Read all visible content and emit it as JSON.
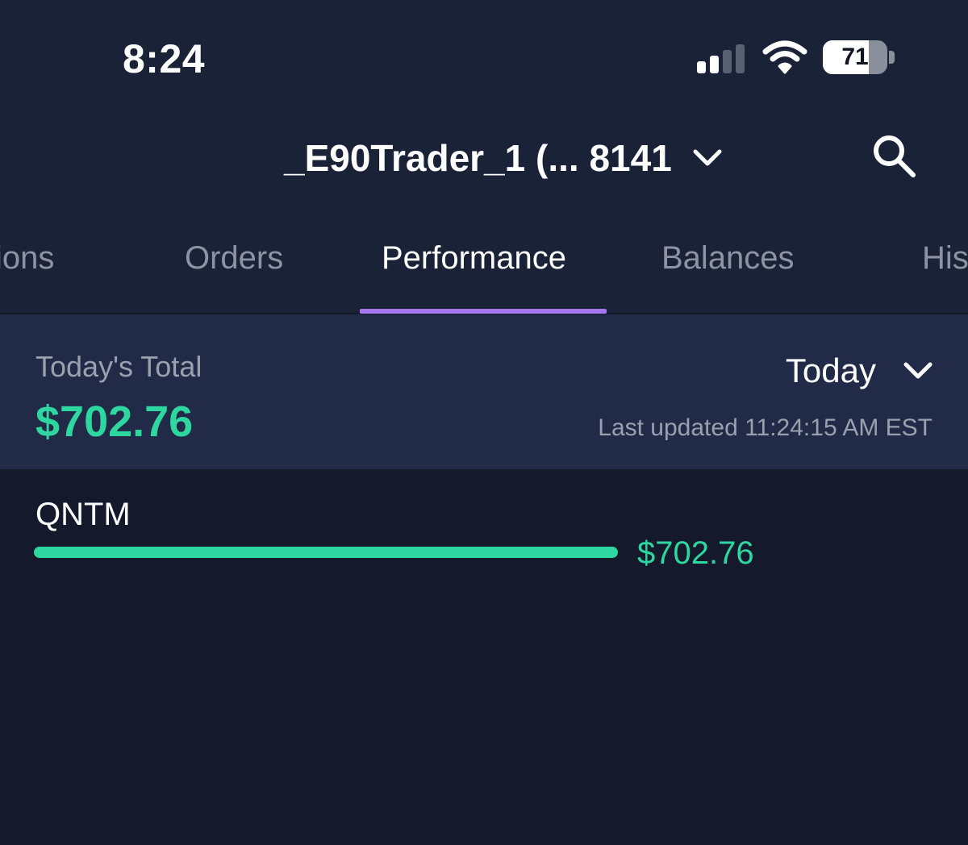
{
  "status_bar": {
    "time": "8:24",
    "battery_level": "71",
    "battery_fraction": 0.71,
    "signal_bars_active": 2,
    "signal_bars_total": 4
  },
  "header": {
    "account_label": "_E90Trader_1 (... 8141",
    "account_dropdown_icon": "chevron-down-icon",
    "search_icon": "search-icon"
  },
  "tabs": [
    {
      "label": "ions",
      "active": false
    },
    {
      "label": "Orders",
      "active": false
    },
    {
      "label": "Performance",
      "active": true
    },
    {
      "label": "Balances",
      "active": false
    },
    {
      "label": "His",
      "active": false
    }
  ],
  "summary": {
    "label": "Today's Total",
    "total": "$702.76",
    "period_label": "Today",
    "last_updated": "Last updated 11:24:15 AM EST"
  },
  "holdings": [
    {
      "symbol": "QNTM",
      "value": "$702.76",
      "share": 1.0
    }
  ],
  "colors": {
    "background": "#141a2b",
    "header_background": "#1a2238",
    "summary_background": "#212b47",
    "accent_green": "#2fd7a0",
    "tab_indicator": "#a678f0",
    "muted_text": "#9aa0ae"
  }
}
